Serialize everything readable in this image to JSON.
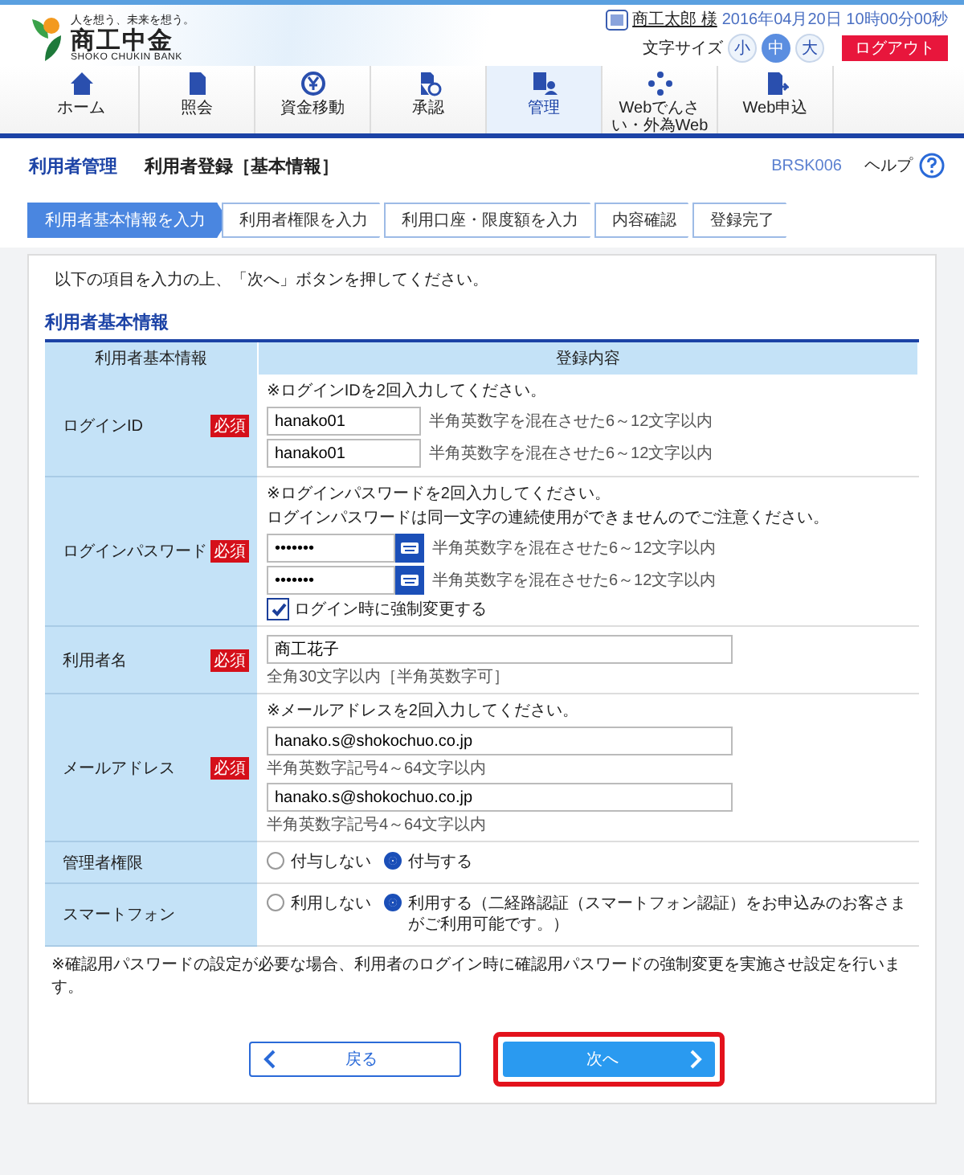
{
  "header": {
    "tagline": "人を想う、未来を想う。",
    "logo_name": "商工中金",
    "logo_sub": "SHOKO CHUKIN BANK",
    "user_name": "商工太郎 様",
    "datetime": "2016年04月20日 10時00分00秒",
    "font_size_label": "文字サイズ",
    "font_sizes": [
      {
        "label": "小",
        "selected": false
      },
      {
        "label": "中",
        "selected": true
      },
      {
        "label": "大",
        "selected": false
      }
    ],
    "logout": "ログアウト"
  },
  "nav": [
    {
      "label": "ホーム",
      "selected": false
    },
    {
      "label": "照会",
      "selected": false
    },
    {
      "label": "資金移動",
      "selected": false
    },
    {
      "label": "承認",
      "selected": false
    },
    {
      "label": "管理",
      "selected": true
    },
    {
      "label": "Webでんさい・外為Web",
      "selected": false
    },
    {
      "label": "Web申込",
      "selected": false
    }
  ],
  "page": {
    "section": "利用者管理",
    "title": "利用者登録［基本情報］",
    "code": "BRSK006",
    "help": "ヘルプ"
  },
  "steps": [
    {
      "label": "利用者基本情報を入力",
      "selected": true
    },
    {
      "label": "利用者権限を入力",
      "selected": false
    },
    {
      "label": "利用口座・限度額を入力",
      "selected": false
    },
    {
      "label": "内容確認",
      "selected": false
    },
    {
      "label": "登録完了",
      "selected": false
    }
  ],
  "instruction": "以下の項目を入力の上、「次へ」ボタンを押してください。",
  "section_title": "利用者基本情報",
  "table": {
    "columns": [
      "利用者基本情報",
      "登録内容"
    ],
    "rows": [
      {
        "label": "ログインID",
        "required": "必須",
        "items": [
          {
            "kind": "note",
            "text": "※ログインIDを2回入力してください。"
          },
          {
            "kind": "input",
            "value": "hanako01",
            "hint": "半角英数字を混在させた6～12文字以内"
          },
          {
            "kind": "input",
            "value": "hanako01",
            "hint": "半角英数字を混在させた6～12文字以内"
          }
        ]
      },
      {
        "label": "ログインパスワード",
        "required": "必須",
        "items": [
          {
            "kind": "note",
            "text": "※ログインパスワードを2回入力してください。"
          },
          {
            "kind": "note",
            "text": "ログインパスワードは同一文字の連続使用ができませんのでご注意ください。"
          },
          {
            "kind": "password",
            "value": "•••••••",
            "hint": "半角英数字を混在させた6～12文字以内"
          },
          {
            "kind": "password",
            "value": "•••••••",
            "hint": "半角英数字を混在させた6～12文字以内"
          },
          {
            "kind": "checkbox",
            "label": "ログイン時に強制変更する",
            "checked": true
          }
        ]
      },
      {
        "label": "利用者名",
        "required": "必須",
        "items": [
          {
            "kind": "wide",
            "value": "商工花子"
          },
          {
            "kind": "hint",
            "text": "全角30文字以内［半角英数字可］"
          }
        ]
      },
      {
        "label": "メールアドレス",
        "required": "必須",
        "items": [
          {
            "kind": "note",
            "text": "※メールアドレスを2回入力してください。"
          },
          {
            "kind": "wide",
            "value": "hanako.s@shokochuo.co.jp"
          },
          {
            "kind": "hint",
            "text": "半角英数字記号4～64文字以内"
          },
          {
            "kind": "wide",
            "value": "hanako.s@shokochuo.co.jp"
          },
          {
            "kind": "hint",
            "text": "半角英数字記号4～64文字以内"
          }
        ]
      },
      {
        "label": "管理者権限",
        "items": [
          {
            "kind": "radios",
            "options": [
              {
                "label": "付与しない",
                "selected": false
              },
              {
                "label": "付与する",
                "selected": true
              }
            ]
          }
        ]
      },
      {
        "label": "スマートフォン",
        "items": [
          {
            "kind": "radios",
            "options": [
              {
                "label": "利用しない",
                "selected": false
              },
              {
                "label": "利用する（二経路認証（スマートフォン認証）をお申込みのお客さまがご利用可能です。）",
                "selected": true
              }
            ]
          }
        ]
      }
    ]
  },
  "footnote": "※確認用パスワードの設定が必要な場合、利用者のログイン時に確認用パスワードの強制変更を実施させ設定を行います。",
  "buttons": [
    {
      "kind": "back",
      "label": "戻る",
      "highlighted": false
    },
    {
      "kind": "next",
      "label": "次へ",
      "highlighted": true
    }
  ]
}
